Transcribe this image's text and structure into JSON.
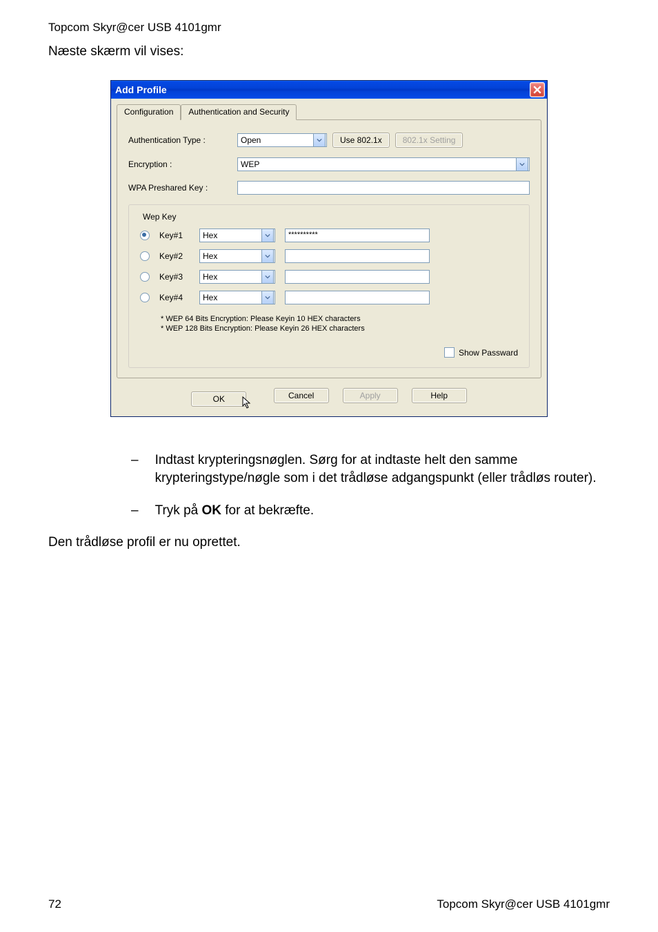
{
  "header": {
    "product": "Topcom Skyr@cer USB 4101gmr",
    "intro": "Næste skærm vil vises:"
  },
  "dialog": {
    "title": "Add Profile",
    "tabs": {
      "configuration": "Configuration",
      "authsec": "Authentication and Security"
    },
    "authType": {
      "label": "Authentication Type :",
      "value": "Open"
    },
    "use8021x": "Use 802.1x",
    "setting": "802.1x Setting",
    "encryption": {
      "label": "Encryption :",
      "value": "WEP"
    },
    "psk": {
      "label": "WPA Preshared Key :",
      "value": ""
    },
    "wep": {
      "legend": "Wep Key",
      "keys": [
        {
          "label": "Key#1",
          "format": "Hex",
          "value": "**********",
          "checked": true
        },
        {
          "label": "Key#2",
          "format": "Hex",
          "value": "",
          "checked": false
        },
        {
          "label": "Key#3",
          "format": "Hex",
          "value": "",
          "checked": false
        },
        {
          "label": "Key#4",
          "format": "Hex",
          "value": "",
          "checked": false
        }
      ],
      "hint1": "* WEP 64 Bits Encryption:   Please Keyin 10 HEX characters",
      "hint2": "* WEP 128 Bits Encryption:   Please Keyin 26 HEX characters"
    },
    "showPassword": "Show Passward",
    "buttons": {
      "ok": "OK",
      "cancel": "Cancel",
      "apply": "Apply",
      "help": "Help"
    }
  },
  "bullets": {
    "b1": "Indtast krypteringsnøglen. Sørg for at indtaste helt den samme krypteringstype/nøgle som i det trådløse adgangspunkt (eller trådløs router).",
    "b2_pre": "Tryk på ",
    "b2_bold": "OK",
    "b2_post": " for at bekræfte."
  },
  "closing": "Den trådløse profil er nu oprettet.",
  "footer": {
    "page": "72",
    "product": "Topcom Skyr@cer USB 4101gmr"
  }
}
